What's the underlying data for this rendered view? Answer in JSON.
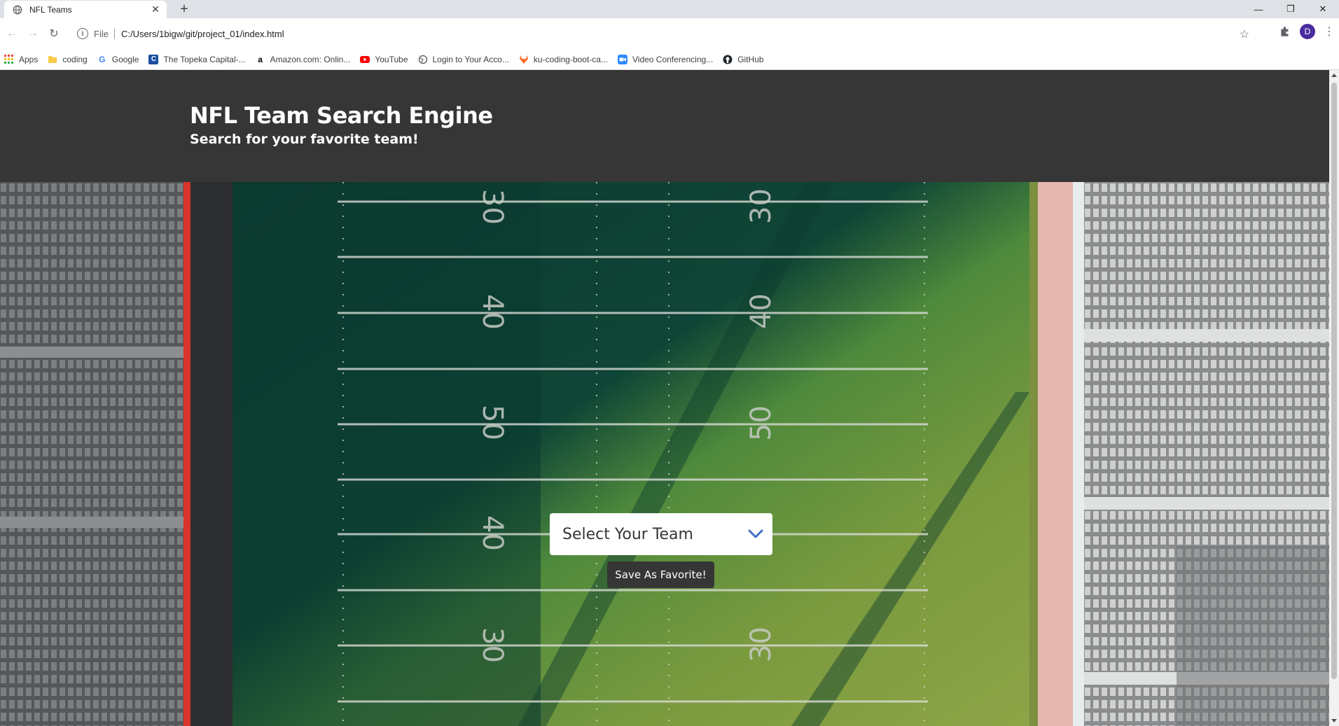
{
  "browser": {
    "tab_title": "NFL Teams",
    "address_scheme": "File",
    "address_url": "C:/Users/1bigw/git/project_01/index.html",
    "profile_initial": "D",
    "bookmarks": [
      {
        "label": "Apps",
        "icon": "apps-grid-icon"
      },
      {
        "label": "coding",
        "icon": "folder-icon"
      },
      {
        "label": "Google",
        "icon": "google-icon"
      },
      {
        "label": "The Topeka Capital-...",
        "icon": "topeka-icon"
      },
      {
        "label": "Amazon.com: Onlin...",
        "icon": "amazon-icon"
      },
      {
        "label": "YouTube",
        "icon": "youtube-icon"
      },
      {
        "label": "Login to Your Acco...",
        "icon": "globe-icon"
      },
      {
        "label": "ku-coding-boot-ca...",
        "icon": "gitlab-icon"
      },
      {
        "label": "Video Conferencing...",
        "icon": "zoom-icon"
      },
      {
        "label": "GitHub",
        "icon": "github-icon"
      }
    ]
  },
  "hero": {
    "title": "NFL Team Search Engine",
    "subtitle": "Search for your favorite team!"
  },
  "form": {
    "select_label": "Select Your Team",
    "save_button": "Save As Favorite!"
  },
  "colors": {
    "hero_bg": "#363636",
    "accent": "#3e6fc8"
  }
}
